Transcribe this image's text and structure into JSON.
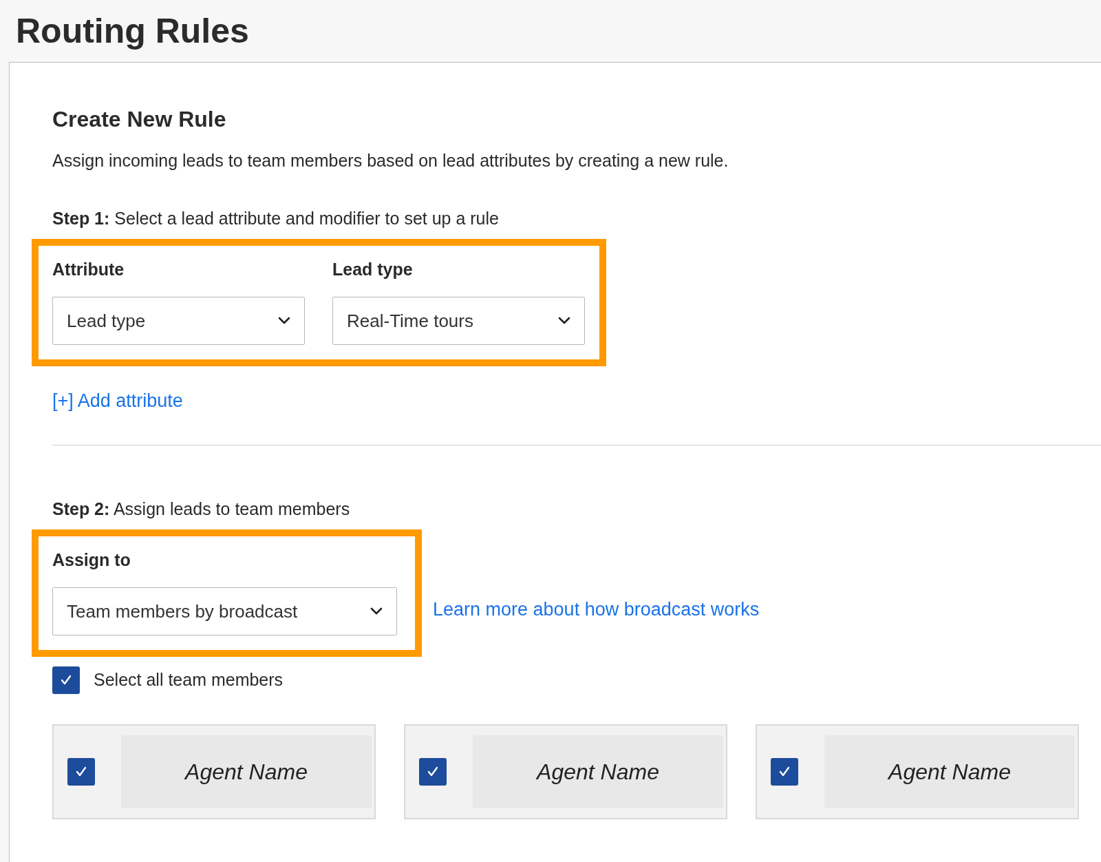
{
  "page_title": "Routing Rules",
  "section_title": "Create New Rule",
  "description": "Assign incoming leads to team members based on lead attributes by creating a new rule.",
  "step1": "**Step 1:** Select a lead attribute and modifier to set up a rule",
  "rule_fields": [
    {
      "label": "Attribute",
      "value": "Lead type"
    },
    {
      "label": "Lead type",
      "value": "Real-Time tours"
    }
  ],
  "add_attribute_link": "[+] Add attribute",
  "step2": "**Step 2:** Assign leads to team members",
  "assign_to": {
    "label": "Assign to",
    "value": "Team members by broadcast"
  },
  "learn_more_link": "Learn more about how broadcast works",
  "select_all": {
    "label": "Select all team members",
    "checked": true
  },
  "agents": [
    {
      "name": "Agent Name",
      "checked": true
    },
    {
      "name": "Agent Name",
      "checked": true
    },
    {
      "name": "Agent Name",
      "checked": true
    }
  ]
}
